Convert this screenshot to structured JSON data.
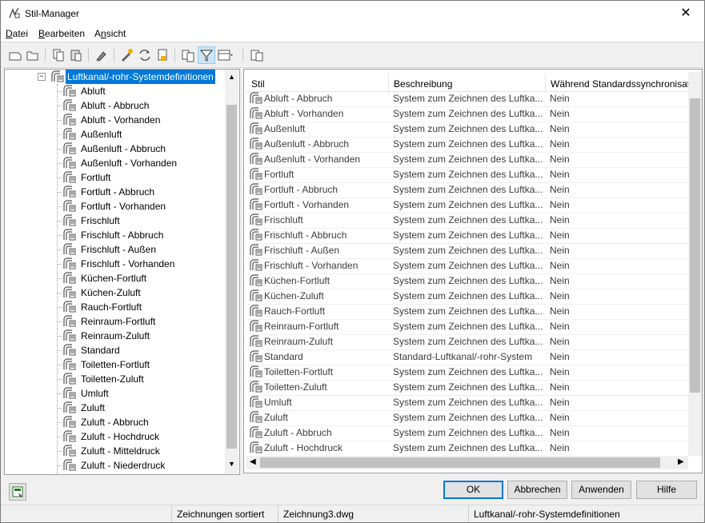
{
  "window": {
    "title": "Stil-Manager",
    "close_glyph": "✕"
  },
  "menu": [
    {
      "label": "Datei",
      "u": "D",
      "rest": "atei"
    },
    {
      "label": "Bearbeiten",
      "u": "B",
      "rest": "earbeiten"
    },
    {
      "label": "Ansicht",
      "pre": "A",
      "u": "n",
      "rest": "sicht"
    }
  ],
  "toolbar": {
    "icons": [
      "new-icon",
      "open-icon",
      "copy-icon",
      "paste-icon",
      "purge-icon",
      "edit-style-icon",
      "sync-icon",
      "settings-icon",
      "toggle-view-icon",
      "filter-icon",
      "view-mode-icon",
      "properties-icon"
    ]
  },
  "tree": {
    "root": "Luftkanal/-rohr-Systemdefinitionen",
    "items": [
      "Abluft",
      "Abluft - Abbruch",
      "Abluft - Vorhanden",
      "Außenluft",
      "Außenluft - Abbruch",
      "Außenluft - Vorhanden",
      "Fortluft",
      "Fortluft - Abbruch",
      "Fortluft - Vorhanden",
      "Frischluft",
      "Frischluft - Abbruch",
      "Frischluft - Außen",
      "Frischluft - Vorhanden",
      "Küchen-Fortluft",
      "Küchen-Zuluft",
      "Rauch-Fortluft",
      "Reinraum-Fortluft",
      "Reinraum-Zuluft",
      "Standard",
      "Toiletten-Fortluft",
      "Toiletten-Zuluft",
      "Umluft",
      "Zuluft",
      "Zuluft - Abbruch",
      "Zuluft - Hochdruck",
      "Zuluft - Mitteldruck",
      "Zuluft - Niederdruck"
    ]
  },
  "list": {
    "columns": [
      "Stil",
      "Beschreibung",
      "Während Standardssynchronisat"
    ],
    "rows": [
      [
        "Abluft - Abbruch",
        "System zum Zeichnen des Luftka...",
        "Nein"
      ],
      [
        "Abluft - Vorhanden",
        "System zum Zeichnen des Luftka...",
        "Nein"
      ],
      [
        "Außenluft",
        "System zum Zeichnen des Luftka...",
        "Nein"
      ],
      [
        "Außenluft - Abbruch",
        "System zum Zeichnen des Luftka...",
        "Nein"
      ],
      [
        "Außenluft - Vorhanden",
        "System zum Zeichnen des Luftka...",
        "Nein"
      ],
      [
        "Fortluft",
        "System zum Zeichnen des Luftka...",
        "Nein"
      ],
      [
        "Fortluft - Abbruch",
        "System zum Zeichnen des Luftka...",
        "Nein"
      ],
      [
        "Fortluft - Vorhanden",
        "System zum Zeichnen des Luftka...",
        "Nein"
      ],
      [
        "Frischluft",
        "System zum Zeichnen des Luftka...",
        "Nein"
      ],
      [
        "Frischluft - Abbruch",
        "System zum Zeichnen des Luftka...",
        "Nein"
      ],
      [
        "Frischluft - Außen",
        "System zum Zeichnen des Luftka...",
        "Nein"
      ],
      [
        "Frischluft - Vorhanden",
        "System zum Zeichnen des Luftka...",
        "Nein"
      ],
      [
        "Küchen-Fortluft",
        "System zum Zeichnen des Luftka...",
        "Nein"
      ],
      [
        "Küchen-Zuluft",
        "System zum Zeichnen des Luftka...",
        "Nein"
      ],
      [
        "Rauch-Fortluft",
        "System zum Zeichnen des Luftka...",
        "Nein"
      ],
      [
        "Reinraum-Fortluft",
        "System zum Zeichnen des Luftka...",
        "Nein"
      ],
      [
        "Reinraum-Zuluft",
        "System zum Zeichnen des Luftka...",
        "Nein"
      ],
      [
        "Standard",
        "Standard-Luftkanal/-rohr-System",
        "Nein"
      ],
      [
        "Toiletten-Fortluft",
        "System zum Zeichnen des Luftka...",
        "Nein"
      ],
      [
        "Toiletten-Zuluft",
        "System zum Zeichnen des Luftka...",
        "Nein"
      ],
      [
        "Umluft",
        "System zum Zeichnen des Luftka...",
        "Nein"
      ],
      [
        "Zuluft",
        "System zum Zeichnen des Luftka...",
        "Nein"
      ],
      [
        "Zuluft - Abbruch",
        "System zum Zeichnen des Luftka...",
        "Nein"
      ],
      [
        "Zuluft - Hochdruck",
        "System zum Zeichnen des Luftka...",
        "Nein"
      ]
    ]
  },
  "buttons": {
    "ok": "OK",
    "cancel": "Abbrechen",
    "apply": "Anwenden",
    "help": "Hilfe"
  },
  "status": {
    "sort": "Zeichnungen sortiert",
    "drawing": "Zeichnung3.dwg",
    "category": "Luftkanal/-rohr-Systemdefinitionen"
  },
  "colors": {
    "selection": "#0078d7",
    "chrome": "#f0f0f0"
  }
}
